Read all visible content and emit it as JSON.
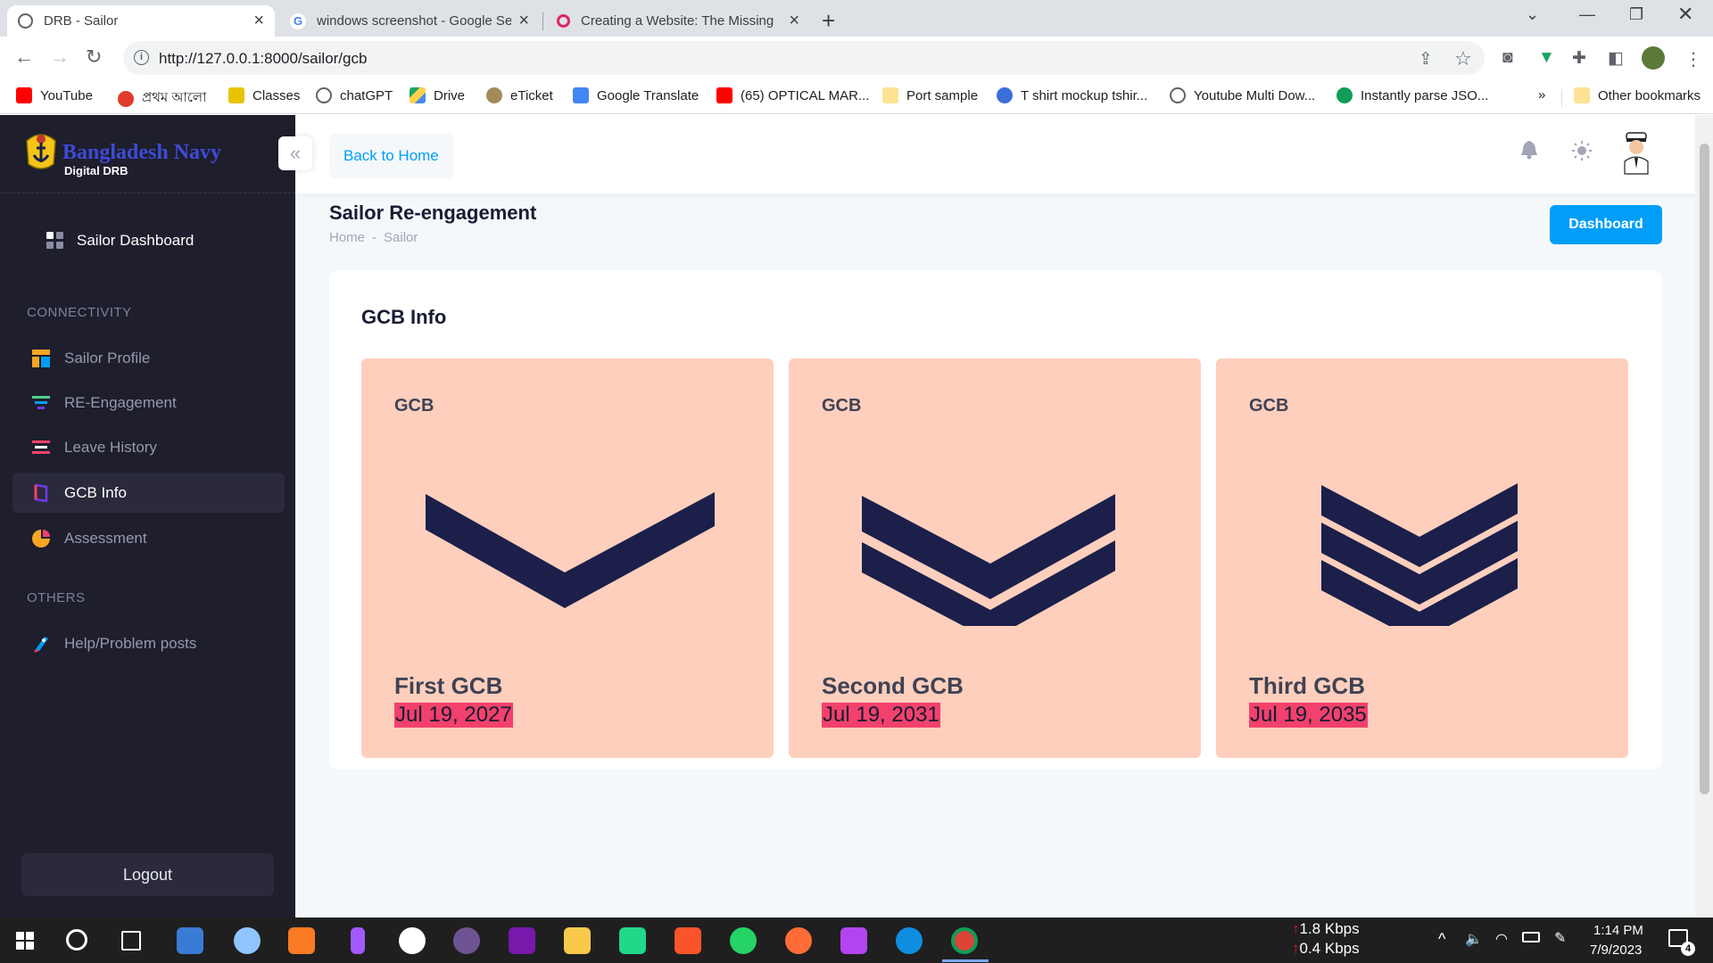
{
  "browser": {
    "tabs": [
      {
        "title": "DRB - Sailor",
        "active": true
      },
      {
        "title": "windows screenshot - Google Se",
        "active": false
      },
      {
        "title": "Creating a Website: The Missing",
        "active": false
      }
    ],
    "url": "http://127.0.0.1:8000/sailor/gcb",
    "bookmarks": [
      "YouTube",
      "প্রথম আলো",
      "Classes",
      "chatGPT",
      "Drive",
      "eTicket",
      "Google Translate",
      "(65) OPTICAL MAR...",
      "Port sample",
      "T shirt mockup tshir...",
      "Youtube Multi Dow...",
      "Instantly parse JSO..."
    ],
    "bookmarks_overflow": "»",
    "other_bookmarks": "Other bookmarks"
  },
  "sidebar": {
    "logo_title": "Bangladesh Navy",
    "logo_subtitle": "Digital DRB",
    "dashboard_label": "Sailor Dashboard",
    "section_connectivity": "CONNECTIVITY",
    "items": [
      {
        "label": "Sailor Profile",
        "icon": "profile-icon"
      },
      {
        "label": "RE-Engagement",
        "icon": "layers-icon"
      },
      {
        "label": "Leave History",
        "icon": "list-icon"
      },
      {
        "label": "GCB Info",
        "icon": "book-icon",
        "active": true
      },
      {
        "label": "Assessment",
        "icon": "pie-icon"
      }
    ],
    "section_others": "OTHERS",
    "help_label": "Help/Problem posts",
    "logout_label": "Logout"
  },
  "topbar": {
    "back_label": "Back to Home"
  },
  "page": {
    "title": "Sailor Re-engagement",
    "breadcrumb": [
      "Home",
      "Sailor"
    ],
    "dashboard_button": "Dashboard",
    "card_title": "GCB Info"
  },
  "gcb_cards": [
    {
      "label": "GCB",
      "name": "First GCB",
      "date": "Jul 19, 2027",
      "stripes": 1
    },
    {
      "label": "GCB",
      "name": "Second GCB",
      "date": "Jul 19, 2031",
      "stripes": 2
    },
    {
      "label": "GCB",
      "name": "Third GCB",
      "date": "Jul 19, 2035",
      "stripes": 3
    }
  ],
  "colors": {
    "sidebar_bg": "#1e1e2d",
    "accent": "#009ef7",
    "card_bg": "#ffcfbd",
    "date_highlight": "#f1416c",
    "chevron": "#1b1f4a"
  },
  "taskbar": {
    "net_up": "1.8 Kbps",
    "net_down": "0.4 Kbps",
    "time": "1:14 PM",
    "date": "7/9/2023",
    "notifications": "4"
  }
}
